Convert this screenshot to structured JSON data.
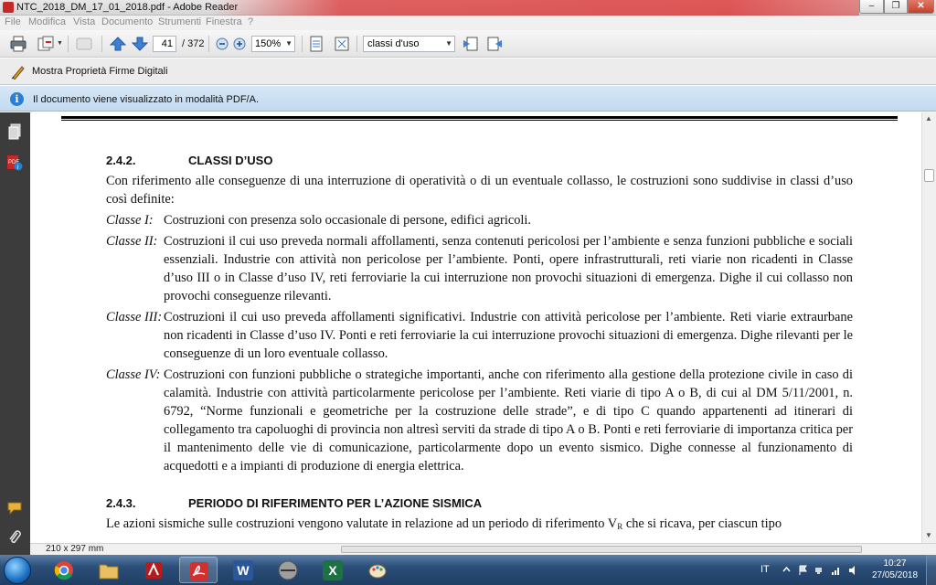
{
  "window": {
    "title": "NTC_2018_DM_17_01_2018.pdf - Adobe Reader",
    "minimize_label": "–",
    "maximize_label": "❐",
    "close_label": "✕"
  },
  "menu": {
    "items": [
      "File",
      "Modifica",
      "Vista",
      "Documento",
      "Strumenti",
      "Finestra",
      "?"
    ]
  },
  "toolbar": {
    "current_page": "41",
    "total_pages": "/ 372",
    "zoom": "150%",
    "search_value": "classi d'uso"
  },
  "signature_bar": {
    "label": "Mostra Proprietà Firme Digitali"
  },
  "info_bar": {
    "icon": "i",
    "text": "Il documento viene visualizzato in modalità PDF/A."
  },
  "document": {
    "section1": {
      "number": "2.4.2.",
      "title": "CLASSI D’USO",
      "intro": "Con riferimento alle conseguenze di una interruzione di operatività o di un eventuale collasso, le costruzioni sono suddivise in classi d’uso così definite:",
      "classes": [
        {
          "name": "Classe I:",
          "text": "Costruzioni con presenza solo occasionale di persone, edifici agricoli."
        },
        {
          "name": "Classe II:",
          "text": "Costruzioni il cui uso preveda normali affollamenti, senza contenuti pericolosi per l’ambiente e senza funzioni pubbliche e sociali essenziali. Industrie con attività non pericolose per l’ambiente. Ponti, opere infrastrutturali, reti viarie non ricadenti in Classe d’uso III o in Classe d’uso IV, reti ferroviarie la cui interruzione non provochi situazioni di emergenza. Dighe il cui collasso non provochi conseguenze rilevanti."
        },
        {
          "name": "Classe III:",
          "text": "Costruzioni il cui uso preveda affollamenti significativi. Industrie con attività pericolose per l’ambiente. Reti viarie extraurbane non ricadenti in Classe d’uso IV. Ponti e reti ferroviarie la cui interruzione provochi situazioni di emergenza. Dighe rilevanti per le conseguenze di un loro eventuale collasso."
        },
        {
          "name": "Classe IV:",
          "text": "Costruzioni con funzioni pubbliche o strategiche importanti, anche con riferimento alla gestione della protezione civile in caso di calamità. Industrie con attività particolarmente pericolose per l’ambiente. Reti viarie di tipo A o B, di cui al DM 5/11/2001, n. 6792, “Norme funzionali e geometriche per la costruzione delle strade”, e di tipo C quando appartenenti ad itinerari di collegamento tra capoluoghi di provincia non altresì serviti da strade di tipo A o B. Ponti e reti ferroviarie di importanza critica per il mantenimento delle vie di comunicazione, particolarmente dopo un evento sismico. Dighe connesse al funzionamento di acquedotti e a impianti di produzione di energia elettrica."
        }
      ]
    },
    "section2": {
      "number": "2.4.3.",
      "title": "PERIODO DI RIFERIMENTO PER L’AZIONE SISMICA",
      "text_before": "Le azioni sismiche sulle costruzioni vengono valutate in relazione ad un periodo di riferimento V",
      "subscript": "R",
      "text_after": " che si ricava, per ciascun tipo"
    }
  },
  "status": {
    "page_size": "210 x 297 mm"
  },
  "taskbar": {
    "language": "IT",
    "time": "10:27",
    "date": "27/05/2018",
    "apps": [
      "chrome",
      "explorer",
      "acrobat-tool",
      "adobe-reader",
      "word",
      "pro-app",
      "excel",
      "paint"
    ],
    "app_glyphs": {
      "word": "W",
      "excel": "X"
    }
  },
  "colors": {
    "infobar": "#c9def2",
    "left_panel": "#3c3c3c",
    "taskbar": "#2b4e78"
  }
}
